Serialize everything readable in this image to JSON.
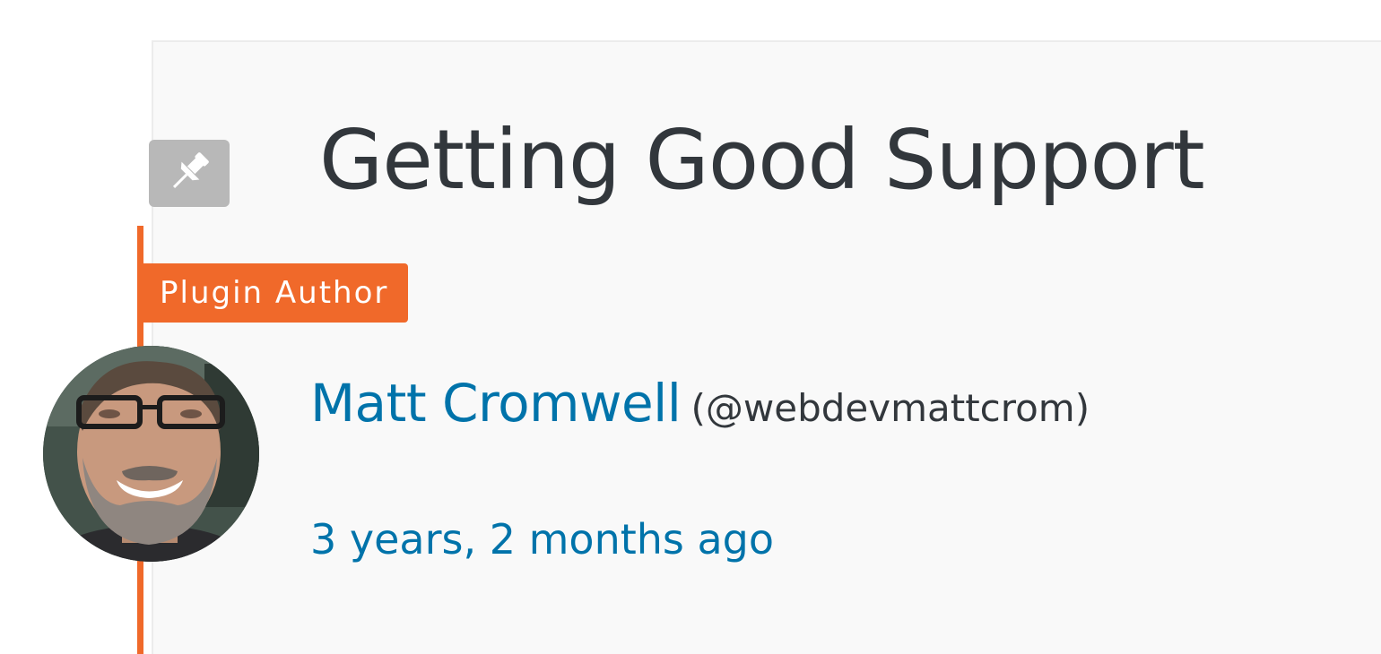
{
  "topic": {
    "title": "Getting Good Support",
    "sticky_icon": "pushpin-icon"
  },
  "author": {
    "role_badge": "Plugin Author",
    "name": "Matt Cromwell",
    "handle": "(@webdevmattcrom)",
    "avatar_icon": "author-avatar"
  },
  "meta": {
    "date": "3 years, 2 months ago"
  },
  "colors": {
    "accent_orange": "#f0692a",
    "link_blue": "#0073aa",
    "title_text": "#32373c",
    "card_bg": "#f9f9f9",
    "sticky_bg": "#b8b8b8"
  }
}
